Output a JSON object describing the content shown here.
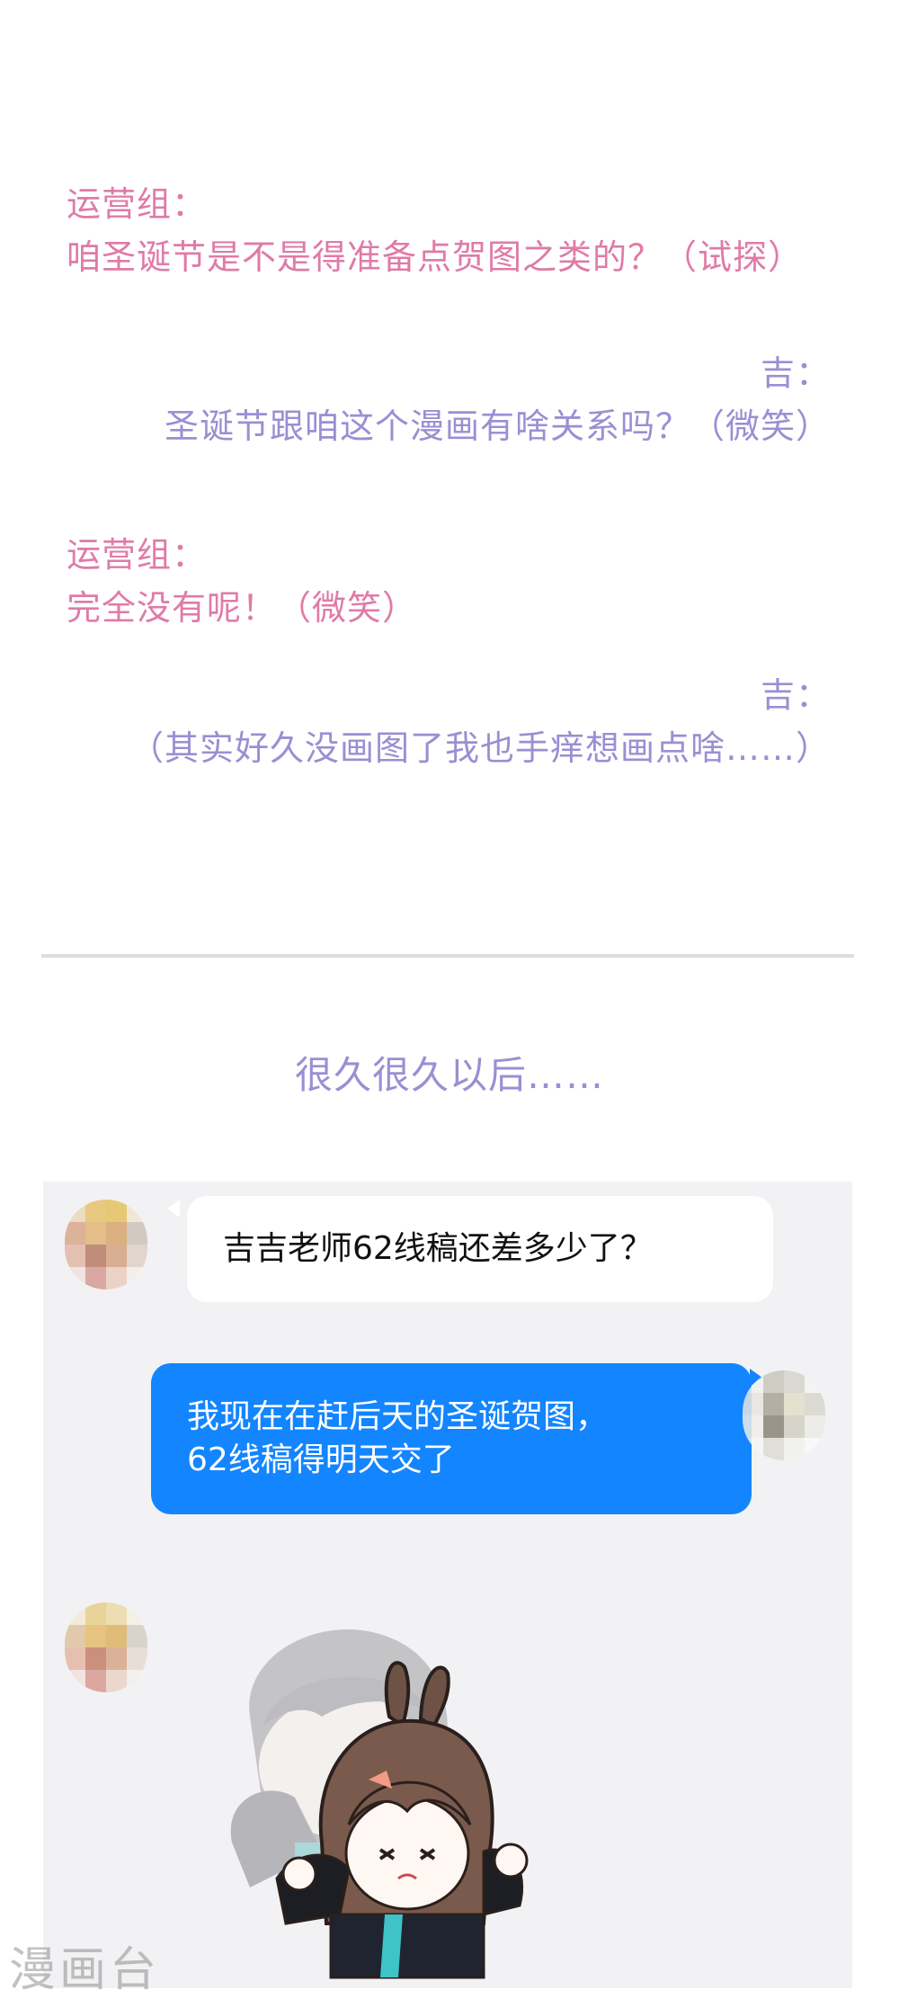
{
  "dialogue": [
    {
      "speaker": "运营组：",
      "text": "咱圣诞节是不是得准备点贺图之类的？（试探）"
    },
    {
      "speaker": "吉：",
      "text": "圣诞节跟咱这个漫画有啥关系吗？（微笑）"
    },
    {
      "speaker": "运营组：",
      "text": "完全没有呢！（微笑）"
    },
    {
      "speaker": "吉：",
      "text": "（其实好久没画图了我也手痒想画点啥……）"
    }
  ],
  "caption": "很久很久以后……",
  "chat": {
    "messages": [
      {
        "direction": "incoming",
        "lines": [
          "吉吉老师62线稿还差多少了？"
        ]
      },
      {
        "direction": "outgoing",
        "lines": [
          "我现在在赶后天的圣诞贺图，",
          "62线稿得明天交了"
        ]
      }
    ]
  },
  "watermark": "漫画台",
  "colors": {
    "operations_text": "#df7ba7",
    "author_text": "#9a8fd3",
    "outgoing_bubble": "#1385ff",
    "chat_background": "#f2f2f4"
  }
}
